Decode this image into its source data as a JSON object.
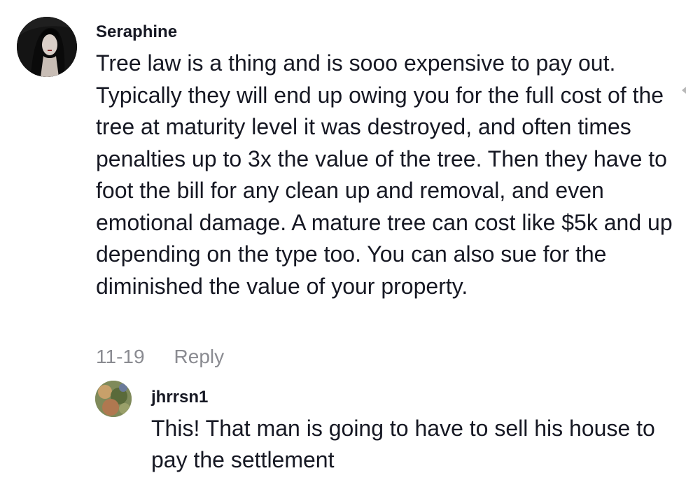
{
  "comment": {
    "username": "Seraphine",
    "text": "Tree law is a thing and is sooo expensive to pay out. Typically they will end up owing you for the full cost of the tree at maturity level it was destroyed, and often times penalties up to 3x the value of the tree. Then they have to foot the bill for any clean up and removal, and even emotional damage. A mature tree can cost like $5k and up depending on the type too. You can also sue for the diminished the value of your property.",
    "date": "11-19",
    "reply_label": "Reply"
  },
  "reply": {
    "username": "jhrrsn1",
    "text": "This! That man is going to have to sell his house to pay the settlement"
  },
  "colors": {
    "text": "#161823",
    "meta": "#8a8b91",
    "background": "#ffffff"
  }
}
